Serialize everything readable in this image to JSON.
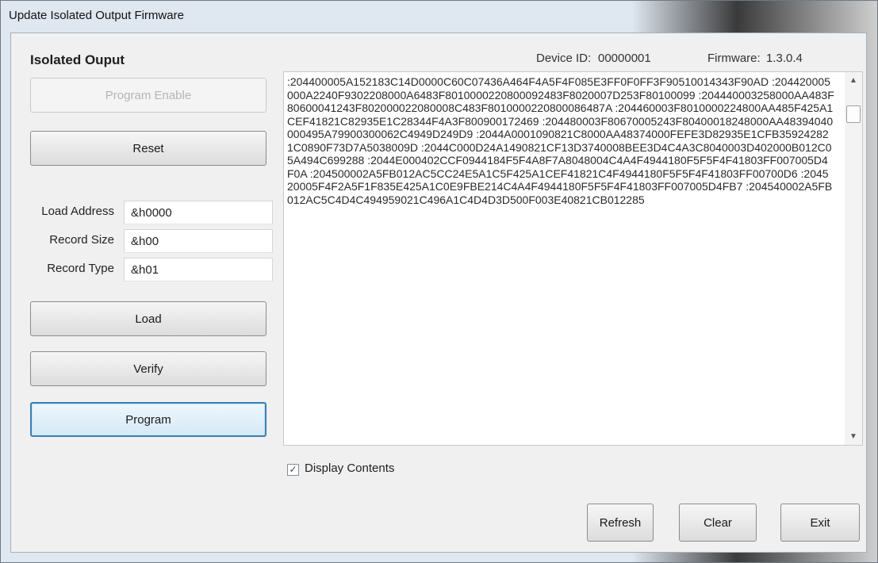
{
  "window": {
    "title": "Update Isolated Output Firmware"
  },
  "panel": {
    "heading": "Isolated Ouput",
    "device_id_label": "Device ID:",
    "device_id_value": "00000001",
    "firmware_label": "Firmware:",
    "firmware_value": "1.3.0.4"
  },
  "buttons": {
    "program_enable": "Program Enable",
    "reset": "Reset",
    "load": "Load",
    "verify": "Verify",
    "program": "Program",
    "refresh": "Refresh",
    "clear": "Clear",
    "exit": "Exit"
  },
  "fields": {
    "load_address_label": "Load Address",
    "load_address_value": "&h0000",
    "record_size_label": "Record Size",
    "record_size_value": "&h00",
    "record_type_label": "Record Type",
    "record_type_value": "&h01"
  },
  "contents": {
    "text": ":204400005A152183C14D0000C60C07436A464F4A5F4F085E3FF0F0FF3F90510014343F90AD :204420005000A2240F9302208000A6483F8010000220800092483F8020007D253F80100099 :204440003258000AA483F80600041243F802000022080008C483F8010000220800086487A :204460003F8010000224800AA485F425A1CEF41821C82935E1C28344F4A3F800900172469 :204480003F80670005243F80400018248000AA48394040000495A79900300062C4949D249D9 :2044A0001090821C8000AA48374000FEFE3D82935E1CFB359242821C0890F73D7A5038009D :2044C000D24A1490821CF13D3740008BEE3D4C4A3C8040003D402000B012C05A494C699288 :2044E000402CCF0944184F5F4A8F7A8048004C4A4F4944180F5F5F4F41803FF007005D4F0A :204500002A5FB012AC5CC24E5A1C5F425A1CEF41821C4F4944180F5F5F4F41803FF00700D6 :204520005F4F2A5F1F835E425A1C0E9FBE214C4A4F4944180F5F5F4F41803FF007005D4FB7 :204540002A5FB012AC5C4D4C494959021C496A1C4D4D3D500F003E40821CB012285",
    "display_contents_label": "Display Contents",
    "display_contents_checked": true
  },
  "icons": {
    "scroll_up": "scroll-up-arrow",
    "scroll_down": "scroll-down-arrow",
    "check": "checkmark"
  }
}
